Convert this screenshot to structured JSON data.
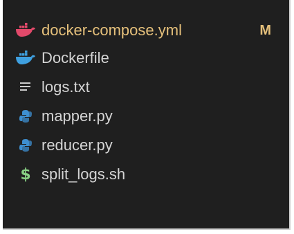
{
  "files": [
    {
      "name": "docker-compose.yml",
      "icon": "docker-icon",
      "icon_color": "#e2496a",
      "modified": true,
      "badge": "M"
    },
    {
      "name": "Dockerfile",
      "icon": "docker-icon",
      "icon_color": "#3fa0e0",
      "modified": false
    },
    {
      "name": "logs.txt",
      "icon": "text-lines-icon",
      "icon_color": "#cccccc",
      "modified": false
    },
    {
      "name": "mapper.py",
      "icon": "python-icon",
      "icon_color": "#3e8fd0",
      "modified": false
    },
    {
      "name": "reducer.py",
      "icon": "python-icon",
      "icon_color": "#3e8fd0",
      "modified": false
    },
    {
      "name": "split_logs.sh",
      "icon": "shell-dollar-icon",
      "icon_color": "#89d185",
      "modified": false
    }
  ],
  "colors": {
    "background": "#1f1f1f",
    "text": "#d4d4d4",
    "modified": "#e5c07b"
  }
}
